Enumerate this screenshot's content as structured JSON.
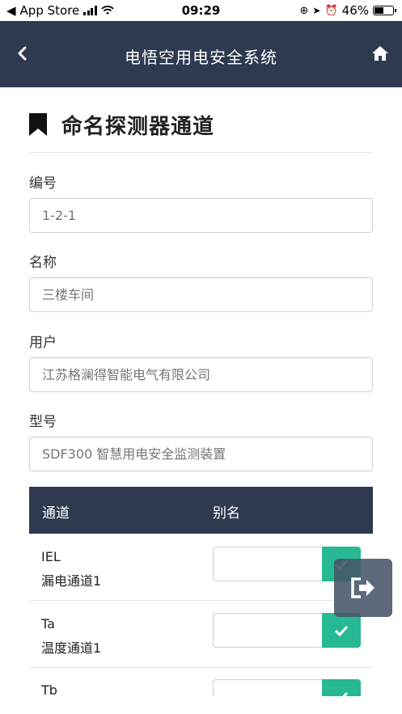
{
  "status_bar": {
    "carrier_back": "App Store",
    "time": "09:29",
    "battery": "46%",
    "battery_level": 0.46
  },
  "nav": {
    "title": "电悟空用电安全系统",
    "back_icon": "chevron-left-icon",
    "home_icon": "home-icon"
  },
  "page": {
    "title": "命名探测器通道",
    "title_icon": "bookmark-icon"
  },
  "form": {
    "fields": [
      {
        "label": "编号",
        "value": "1-2-1"
      },
      {
        "label": "名称",
        "value": "三楼车间"
      },
      {
        "label": "用户",
        "value": "江苏格澜得智能电气有限公司"
      },
      {
        "label": "型号",
        "value": "SDF300 智慧用电安全监测装置"
      }
    ]
  },
  "table": {
    "headers": {
      "channel": "通道",
      "alias": "别名"
    },
    "rows": [
      {
        "code": "IEL",
        "name": "漏电通道1",
        "alias": ""
      },
      {
        "code": "Ta",
        "name": "温度通道1",
        "alias": ""
      },
      {
        "code": "Tb",
        "name": "",
        "alias": ""
      }
    ],
    "confirm_icon": "check-icon"
  },
  "floating": {
    "exit_icon": "exit-icon"
  },
  "colors": {
    "nav_bg": "#2e3a4f",
    "accent_green": "#27b894",
    "float_bg": "#465468"
  }
}
